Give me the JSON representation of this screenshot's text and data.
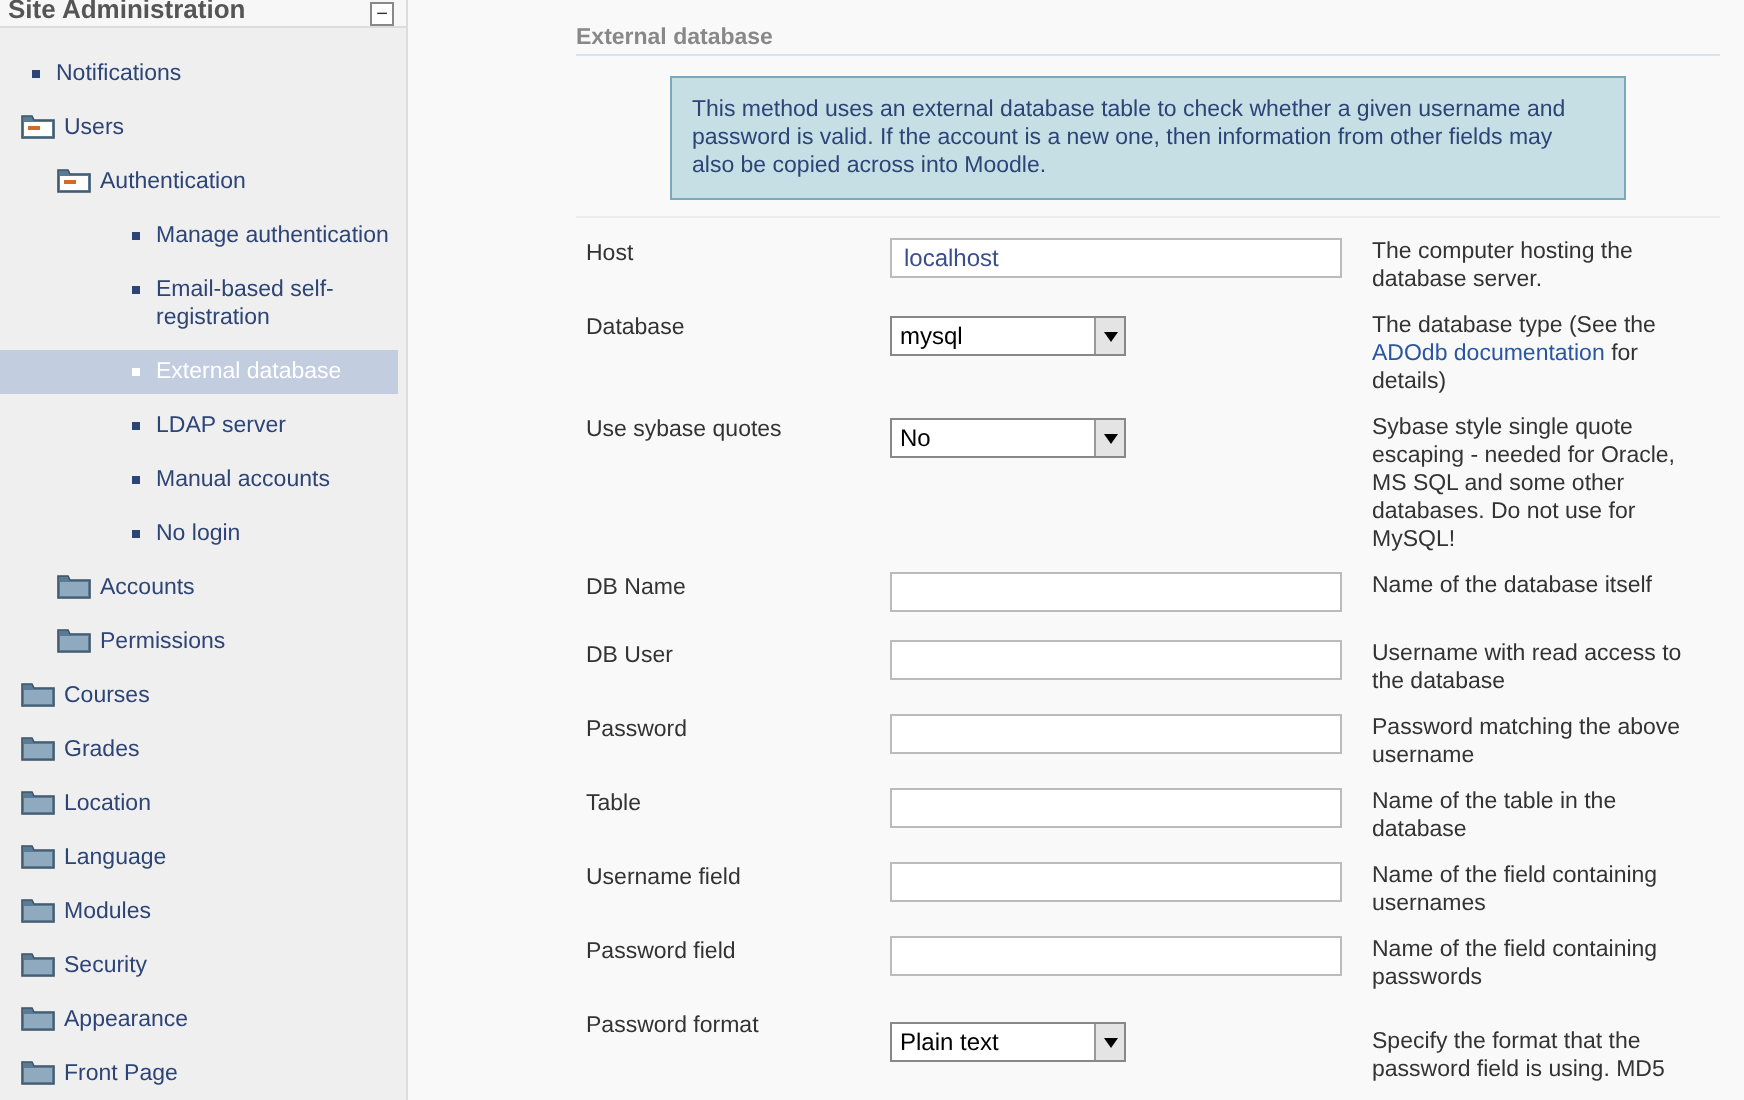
{
  "sidebar": {
    "title": "Site Administration",
    "collapse_icon": "−",
    "items": [
      {
        "label": "Notifications",
        "kind": "leaf",
        "selected": false
      },
      {
        "label": "Users",
        "kind": "folder",
        "expanded": true,
        "selected": false,
        "children": [
          {
            "label": "Authentication",
            "kind": "folder",
            "expanded": true,
            "selected": false,
            "children": [
              {
                "label": "Manage authentication",
                "kind": "leaf",
                "selected": false
              },
              {
                "label": "Email-based self-registration",
                "kind": "leaf",
                "selected": false
              },
              {
                "label": "External database",
                "kind": "leaf",
                "selected": true
              },
              {
                "label": "LDAP server",
                "kind": "leaf",
                "selected": false
              },
              {
                "label": "Manual accounts",
                "kind": "leaf",
                "selected": false
              },
              {
                "label": "No login",
                "kind": "leaf",
                "selected": false
              }
            ]
          },
          {
            "label": "Accounts",
            "kind": "folder",
            "expanded": false,
            "selected": false
          },
          {
            "label": "Permissions",
            "kind": "folder",
            "expanded": false,
            "selected": false
          }
        ]
      },
      {
        "label": "Courses",
        "kind": "folder",
        "expanded": false,
        "selected": false
      },
      {
        "label": "Grades",
        "kind": "folder",
        "expanded": false,
        "selected": false
      },
      {
        "label": "Location",
        "kind": "folder",
        "expanded": false,
        "selected": false
      },
      {
        "label": "Language",
        "kind": "folder",
        "expanded": false,
        "selected": false
      },
      {
        "label": "Modules",
        "kind": "folder",
        "expanded": false,
        "selected": false
      },
      {
        "label": "Security",
        "kind": "folder",
        "expanded": false,
        "selected": false
      },
      {
        "label": "Appearance",
        "kind": "folder",
        "expanded": false,
        "selected": false
      },
      {
        "label": "Front Page",
        "kind": "folder",
        "expanded": false,
        "selected": false
      }
    ]
  },
  "section": {
    "title": "External database",
    "info": "This method uses an external database table to check whether a given username and password is valid. If the account is a new one, then information from other fields may also be copied across into Moodle.",
    "settings": [
      {
        "label": "Host",
        "kind": "text",
        "value": "localhost",
        "description": "The computer hosting the database server."
      },
      {
        "label": "Database",
        "kind": "select",
        "value": "mysql",
        "description": "The database type (See the",
        "link": "ADOdb documentation",
        "description_end": "for details)"
      },
      {
        "label": "Use sybase quotes",
        "kind": "select",
        "value": "No",
        "description": "Sybase style single quote escaping - needed for Oracle, MS SQL and some other databases. Do not use for MySQL!"
      },
      {
        "label": "DB Name",
        "kind": "text",
        "description": "Name of the database itself"
      },
      {
        "label": "DB User",
        "kind": "text",
        "description": "Username with read access to the database"
      },
      {
        "label": "Password",
        "kind": "text",
        "description": "Password matching the above username"
      },
      {
        "label": "Table",
        "kind": "text",
        "description": "Name of the table in the database"
      },
      {
        "label": "Username field",
        "kind": "text",
        "description": "Name of the field containing usernames"
      },
      {
        "label": "Password field",
        "kind": "text",
        "description": "Name of the field containing passwords"
      },
      {
        "label": "Password format",
        "kind": "select",
        "value": "Plain text",
        "description": "Specify the format that the password field is using. MD5"
      }
    ]
  }
}
